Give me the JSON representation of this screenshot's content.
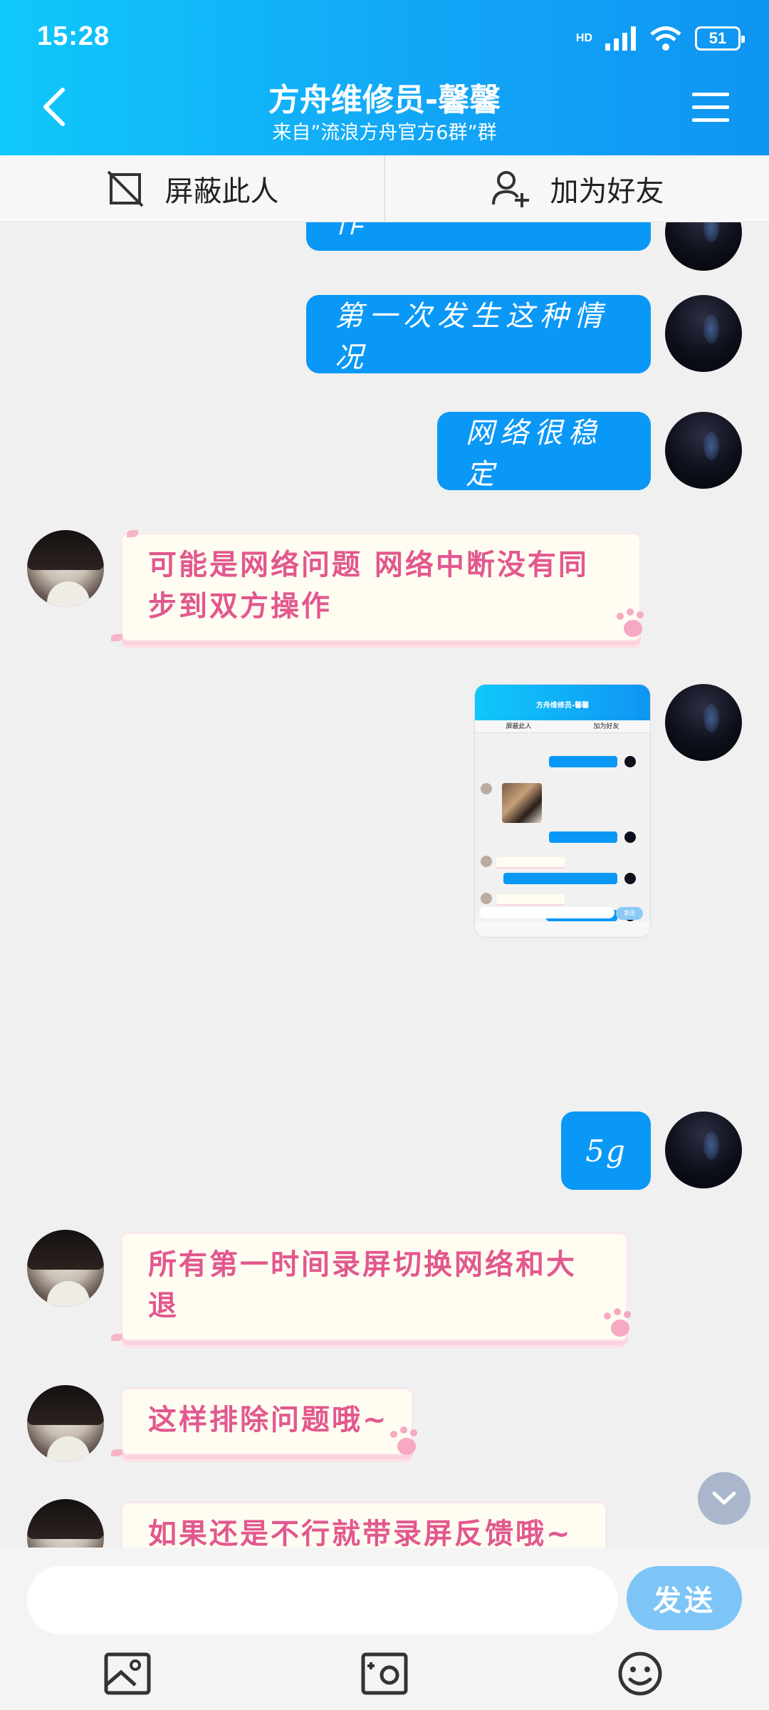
{
  "status": {
    "time": "15:28",
    "network": "HD",
    "battery": "51"
  },
  "header": {
    "title": "方舟维修员-馨馨",
    "subtitle": "来自”流浪方舟官方6群”群"
  },
  "actions": {
    "block_label": "屏蔽此人",
    "add_friend_label": "加为好友"
  },
  "messages": {
    "partial_top": "没有，我没乱动操作",
    "me_1": "第一次发生这种情况",
    "me_2": "网络很稳定",
    "her_1": "可能是网络问题 网络中断没有同步到双方操作",
    "me_3": "5g",
    "her_2": "所有第一时间录屏切换网络和大退",
    "her_3": "这样排除问题哦~",
    "her_4": "如果还是不行就带录屏反馈哦~"
  },
  "thumbnail": {
    "title": "方舟维修员-馨馨",
    "block_label": "屏蔽此人",
    "add_friend_label": "加为好友",
    "send_label": "发送"
  },
  "input": {
    "placeholder": "",
    "send_label": "发送"
  },
  "toolbar": {
    "icons": [
      "image-icon",
      "camera-icon",
      "emoji-icon"
    ]
  },
  "colors": {
    "header_blue": "#12a6f6",
    "my_bubble": "#0a98f7",
    "her_text": "#e2588e",
    "send_button": "#7cc5f6"
  }
}
